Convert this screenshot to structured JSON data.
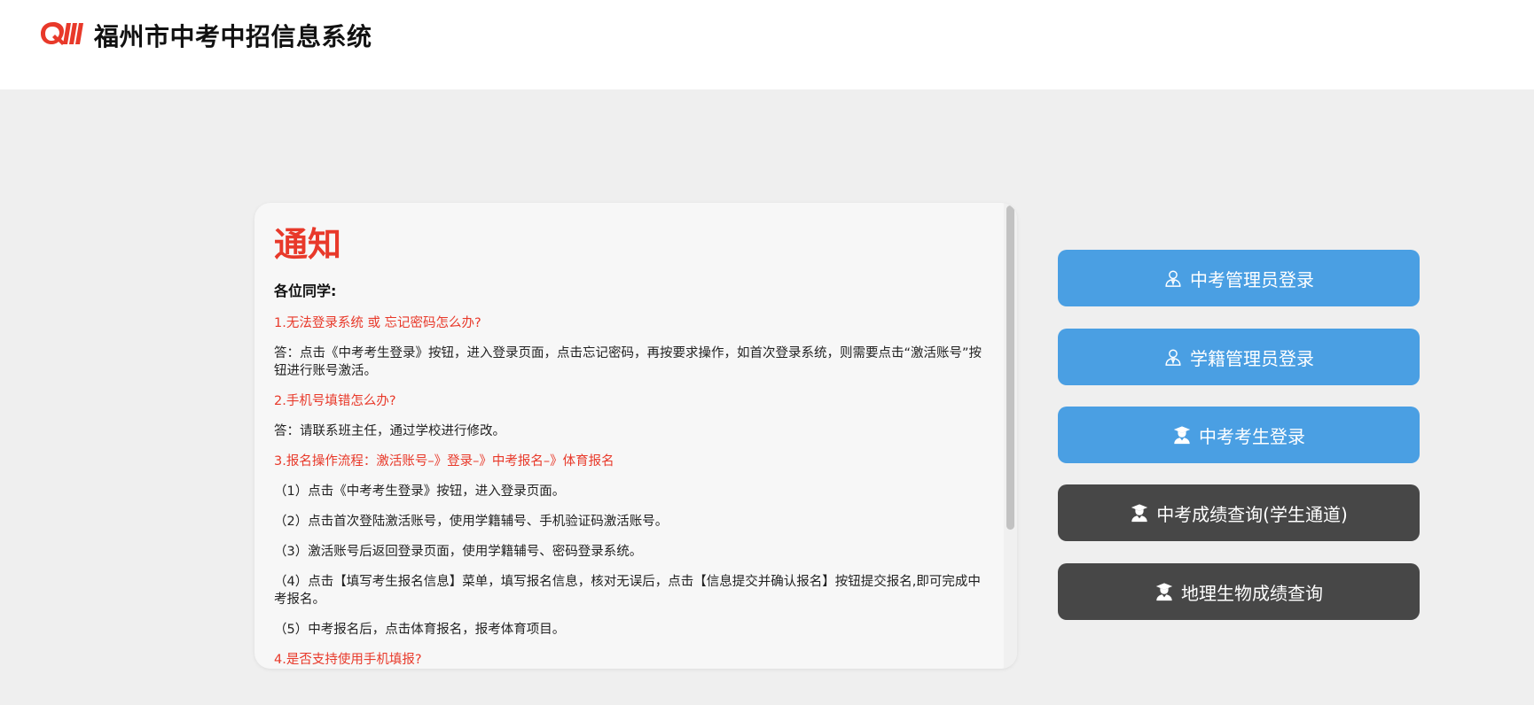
{
  "header": {
    "title": "福州市中考中招信息系统",
    "logo_icon": "brand-logo-icon",
    "brand_color": "#e8392a"
  },
  "notice": {
    "title": "通知",
    "greeting": "各位同学:",
    "items": [
      {
        "type": "q",
        "text": "1.无法登录系统 或 忘记密码怎么办?"
      },
      {
        "type": "a",
        "text": "答：点击《中考考生登录》按钮，进入登录页面，点击忘记密码，再按要求操作，如首次登录系统，则需要点击“激活账号”按钮进行账号激活。"
      },
      {
        "type": "q",
        "text": "2.手机号填错怎么办?"
      },
      {
        "type": "a",
        "text": "答：请联系班主任，通过学校进行修改。"
      },
      {
        "type": "q",
        "text": "3.报名操作流程：激活账号–》登录–》中考报名–》体育报名"
      },
      {
        "type": "a",
        "text": "（1）点击《中考考生登录》按钮，进入登录页面。"
      },
      {
        "type": "a",
        "text": "（2）点击首次登陆激活账号，使用学籍辅号、手机验证码激活账号。"
      },
      {
        "type": "a",
        "text": "（3）激活账号后返回登录页面，使用学籍辅号、密码登录系统。"
      },
      {
        "type": "a",
        "text": "（4）点击【填写考生报名信息】菜单，填写报名信息，核对无误后，点击【信息提交并确认报名】按钮提交报名,即可完成中考报名。"
      },
      {
        "type": "a",
        "text": "（5）中考报名后，点击体育报名，报考体育项目。"
      },
      {
        "type": "q",
        "text": "4.是否支持使用手机填报?"
      }
    ]
  },
  "buttons": [
    {
      "label": "中考管理员登录",
      "icon": "user-admin-icon",
      "color": "#4a9fe3"
    },
    {
      "label": "学籍管理员登录",
      "icon": "user-admin-icon",
      "color": "#4a9fe3"
    },
    {
      "label": "中考考生登录",
      "icon": "student-icon",
      "color": "#4a9fe3"
    },
    {
      "label": "中考成绩查询(学生通道)",
      "icon": "student-icon",
      "color": "#474747"
    },
    {
      "label": "地理生物成绩查询",
      "icon": "student-icon",
      "color": "#474747"
    }
  ]
}
